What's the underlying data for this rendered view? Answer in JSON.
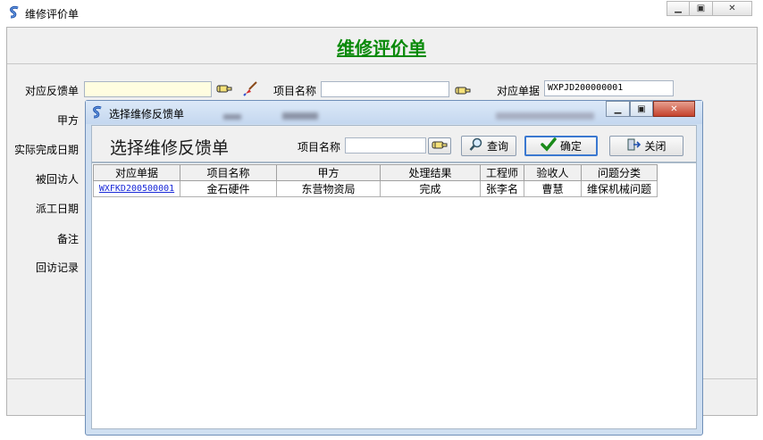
{
  "main_window": {
    "title": "维修评价单",
    "heading": "维修评价单",
    "fields": {
      "feedback_label": "对应反馈单",
      "feedback_value": "",
      "project_label": "项目名称",
      "project_value": "",
      "doc_label": "对应单据",
      "doc_value": "WXPJD200000001",
      "party_a_label": "甲方",
      "completion_label": "实际完成日期",
      "visitee_label": "被回访人",
      "dispatch_label": "派工日期",
      "remark_label": "备注",
      "visit_record_label": "回访记录"
    }
  },
  "dialog": {
    "title": "选择维修反馈单",
    "heading": "选择维修反馈单",
    "search_label": "项目名称",
    "search_value": "",
    "query_label": "查询",
    "confirm_label": "确定",
    "close_label": "关闭",
    "columns": [
      "对应单据",
      "项目名称",
      "甲方",
      "处理结果",
      "工程师",
      "验收人",
      "问题分类"
    ],
    "rows": [
      [
        "WXFKD200500001",
        "金石硬件",
        "东营物资局",
        "完成",
        "张李名",
        "曹慧",
        "维保机械问题"
      ]
    ]
  },
  "colors": {
    "heading_green": "#0a8a0a",
    "link_blue": "#1a2ad8",
    "dialog_frame": "#cfdff1",
    "close_red": "#c4422c"
  }
}
